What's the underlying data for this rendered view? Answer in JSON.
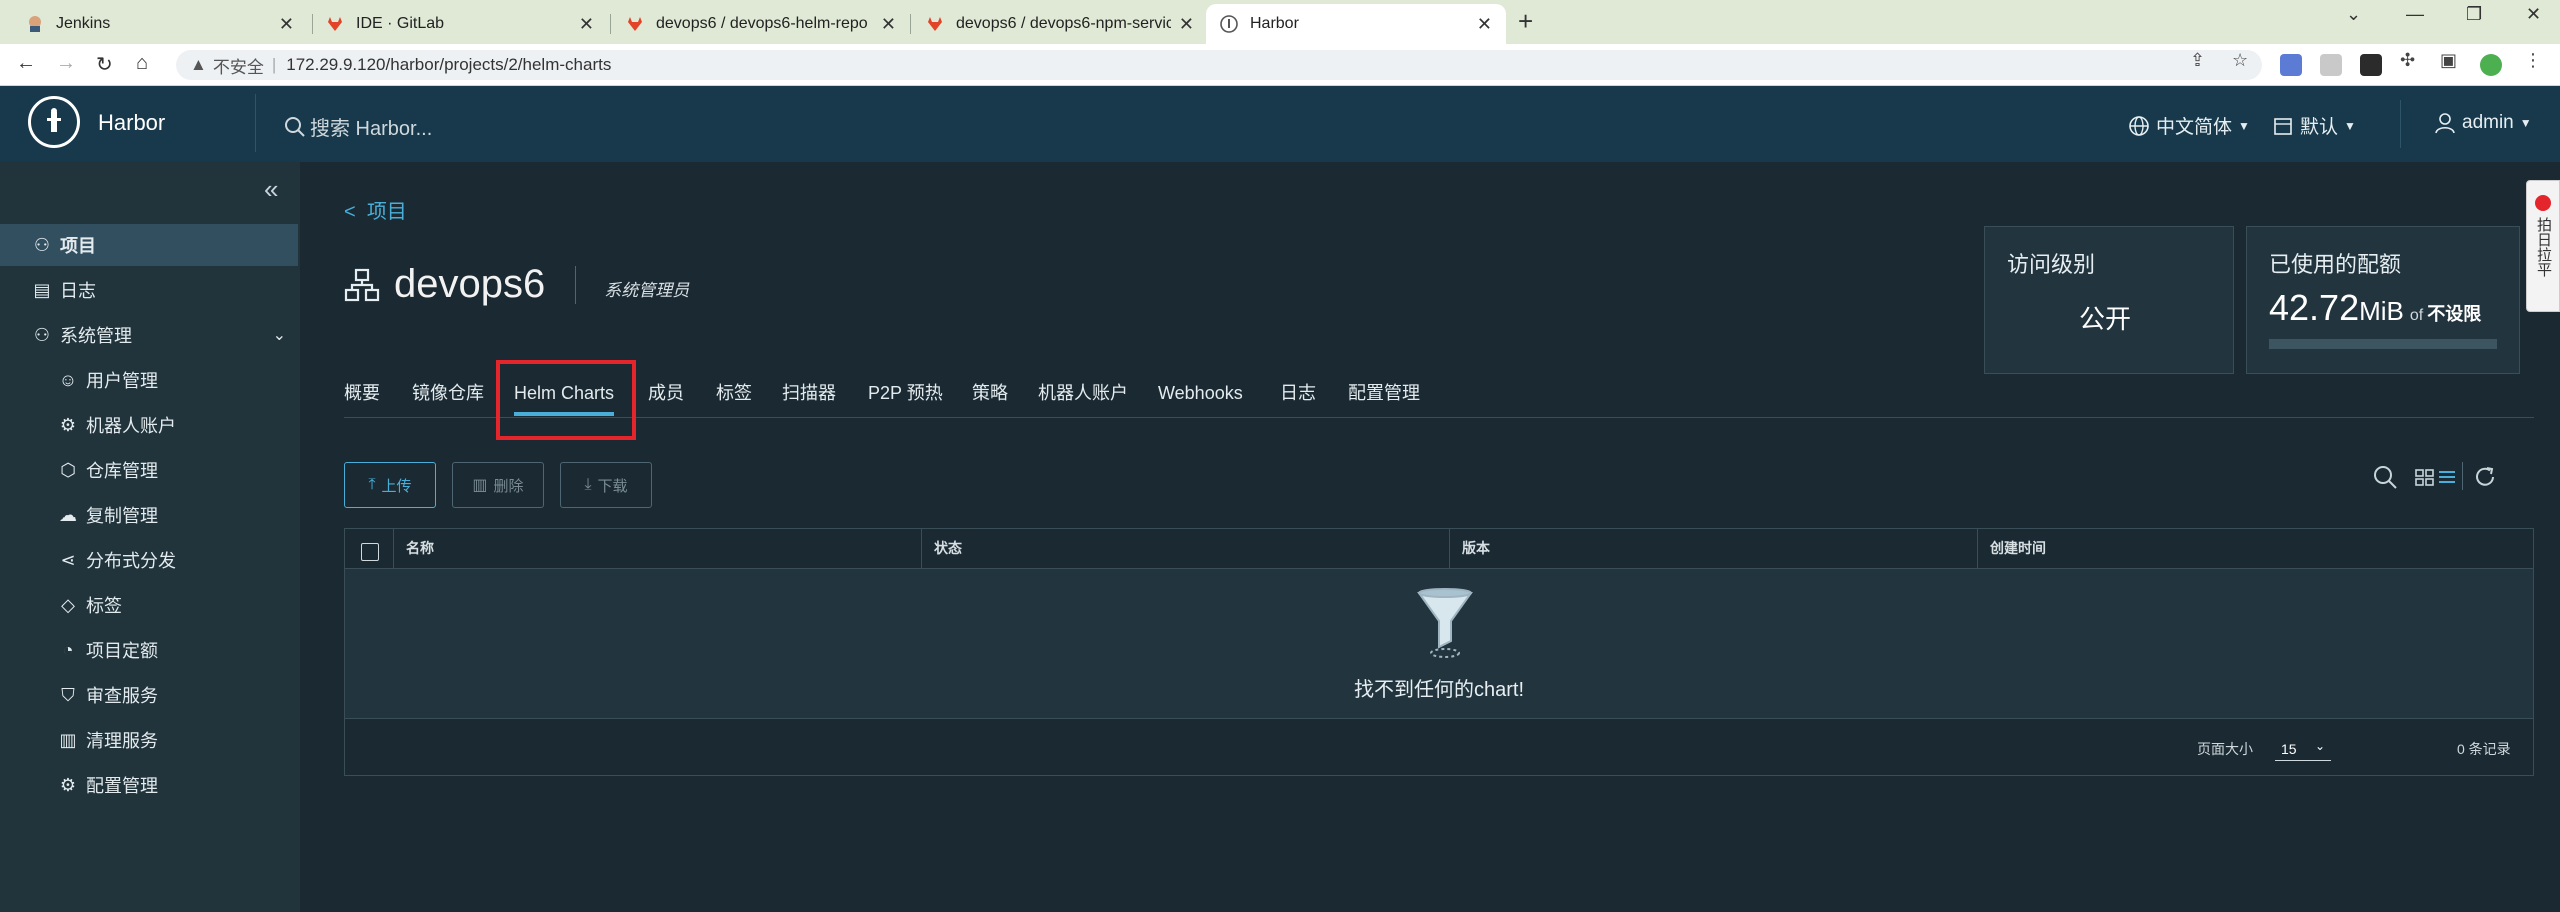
{
  "browser": {
    "tabs": [
      {
        "title": "Jenkins",
        "favicon": "jenkins-icon"
      },
      {
        "title": "IDE · GitLab",
        "favicon": "gitlab-icon"
      },
      {
        "title": "devops6 / devops6-helm-repo",
        "favicon": "gitlab-icon"
      },
      {
        "title": "devops6 / devops6-npm-servic",
        "favicon": "gitlab-icon"
      },
      {
        "title": "Harbor",
        "favicon": "harbor-icon",
        "active": true
      }
    ],
    "security_label": "不安全",
    "url": "172.29.9.120/harbor/projects/2/helm-charts",
    "accent": "#dfe9d5"
  },
  "header": {
    "brand": "Harbor",
    "search_placeholder": "搜索 Harbor...",
    "language": "中文简体",
    "theme": "默认",
    "user": "admin",
    "bg_color": "#17394b"
  },
  "sidebar": {
    "items": [
      {
        "label": "项目",
        "icon": "project-icon",
        "active": true
      },
      {
        "label": "日志",
        "icon": "log-icon"
      },
      {
        "label": "系统管理",
        "icon": "admin-icon",
        "expanded": true
      },
      {
        "label": "用户管理",
        "icon": "users-icon"
      },
      {
        "label": "机器人账户",
        "icon": "robot-icon"
      },
      {
        "label": "仓库管理",
        "icon": "registry-icon"
      },
      {
        "label": "复制管理",
        "icon": "replication-icon"
      },
      {
        "label": "分布式分发",
        "icon": "share-icon"
      },
      {
        "label": "标签",
        "icon": "tag-icon"
      },
      {
        "label": "项目定额",
        "icon": "quota-icon"
      },
      {
        "label": "审查服务",
        "icon": "shield-icon"
      },
      {
        "label": "清理服务",
        "icon": "trash-icon"
      },
      {
        "label": "配置管理",
        "icon": "gear-icon"
      }
    ]
  },
  "project": {
    "back_label": "项目",
    "name": "devops6",
    "role": "系统管理员",
    "access_card": {
      "title": "访问级别",
      "value": "公开"
    },
    "quota_card": {
      "title": "已使用的配额",
      "used": "42.72",
      "unit": "MiB",
      "of": "of",
      "limit": "不设限"
    }
  },
  "tabs": [
    "概要",
    "镜像仓库",
    "Helm Charts",
    "成员",
    "标签",
    "扫描器",
    "P2P 预热",
    "策略",
    "机器人账户",
    "Webhooks",
    "日志",
    "配置管理"
  ],
  "active_tab": "Helm Charts",
  "actions": {
    "upload": "上传",
    "delete": "删除",
    "download": "下载"
  },
  "table": {
    "columns": [
      "名称",
      "状态",
      "版本",
      "创建时间"
    ],
    "empty_message": "找不到任何的chart!",
    "page_size_label": "页面大小",
    "page_size": "15",
    "record_count": "0 条记录"
  },
  "side_widget": {
    "text": "拍日拉平"
  }
}
